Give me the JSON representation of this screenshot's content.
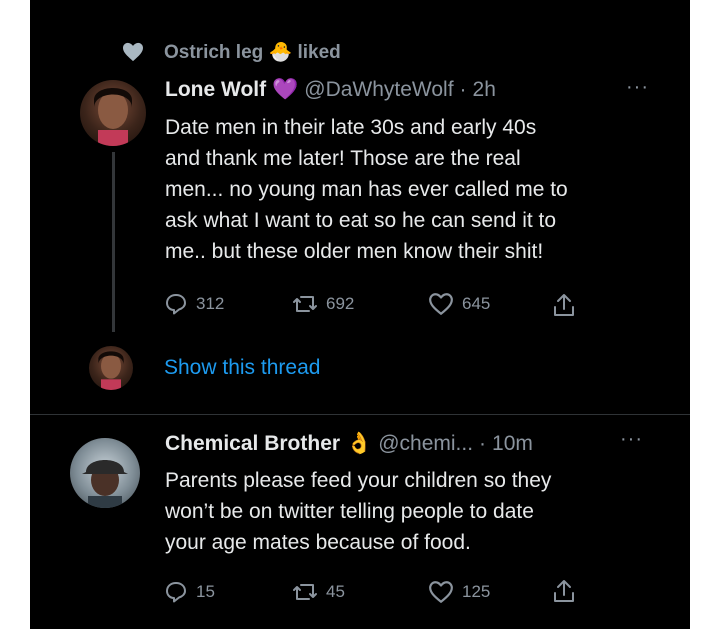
{
  "social_context": {
    "user": "Ostrich leg",
    "emoji": "🐣",
    "action": "liked"
  },
  "tweet1": {
    "name": "Lone Wolf",
    "badge_emoji": "💜",
    "handle": "@DaWhyteWolf",
    "separator": "·",
    "time": "2h",
    "more": "···",
    "lines": [
      "Date men in their late 30s and early 40s",
      "and thank me later! Those are the real",
      "men... no young man has ever called me to",
      "ask what I want to eat so he can send it to",
      "me.. but these older men know their shit!"
    ],
    "replies": "312",
    "retweets": "692",
    "likes": "645"
  },
  "show_thread": "Show this thread",
  "tweet2": {
    "name": "Chemical Brother",
    "badge_emoji": "👌",
    "handle": "@chemi...",
    "separator": "·",
    "time": "10m",
    "more": "···",
    "lines": [
      "Parents please feed your children so they",
      "won’t be on twitter telling people to date",
      "your age mates because of food."
    ],
    "replies": "15",
    "retweets": "45",
    "likes": "125"
  },
  "colors": {
    "background": "#000000",
    "text": "#e7e9ea",
    "secondary": "#8b949e",
    "link": "#1d9bf0",
    "heart_liked": "#aab8c2"
  }
}
